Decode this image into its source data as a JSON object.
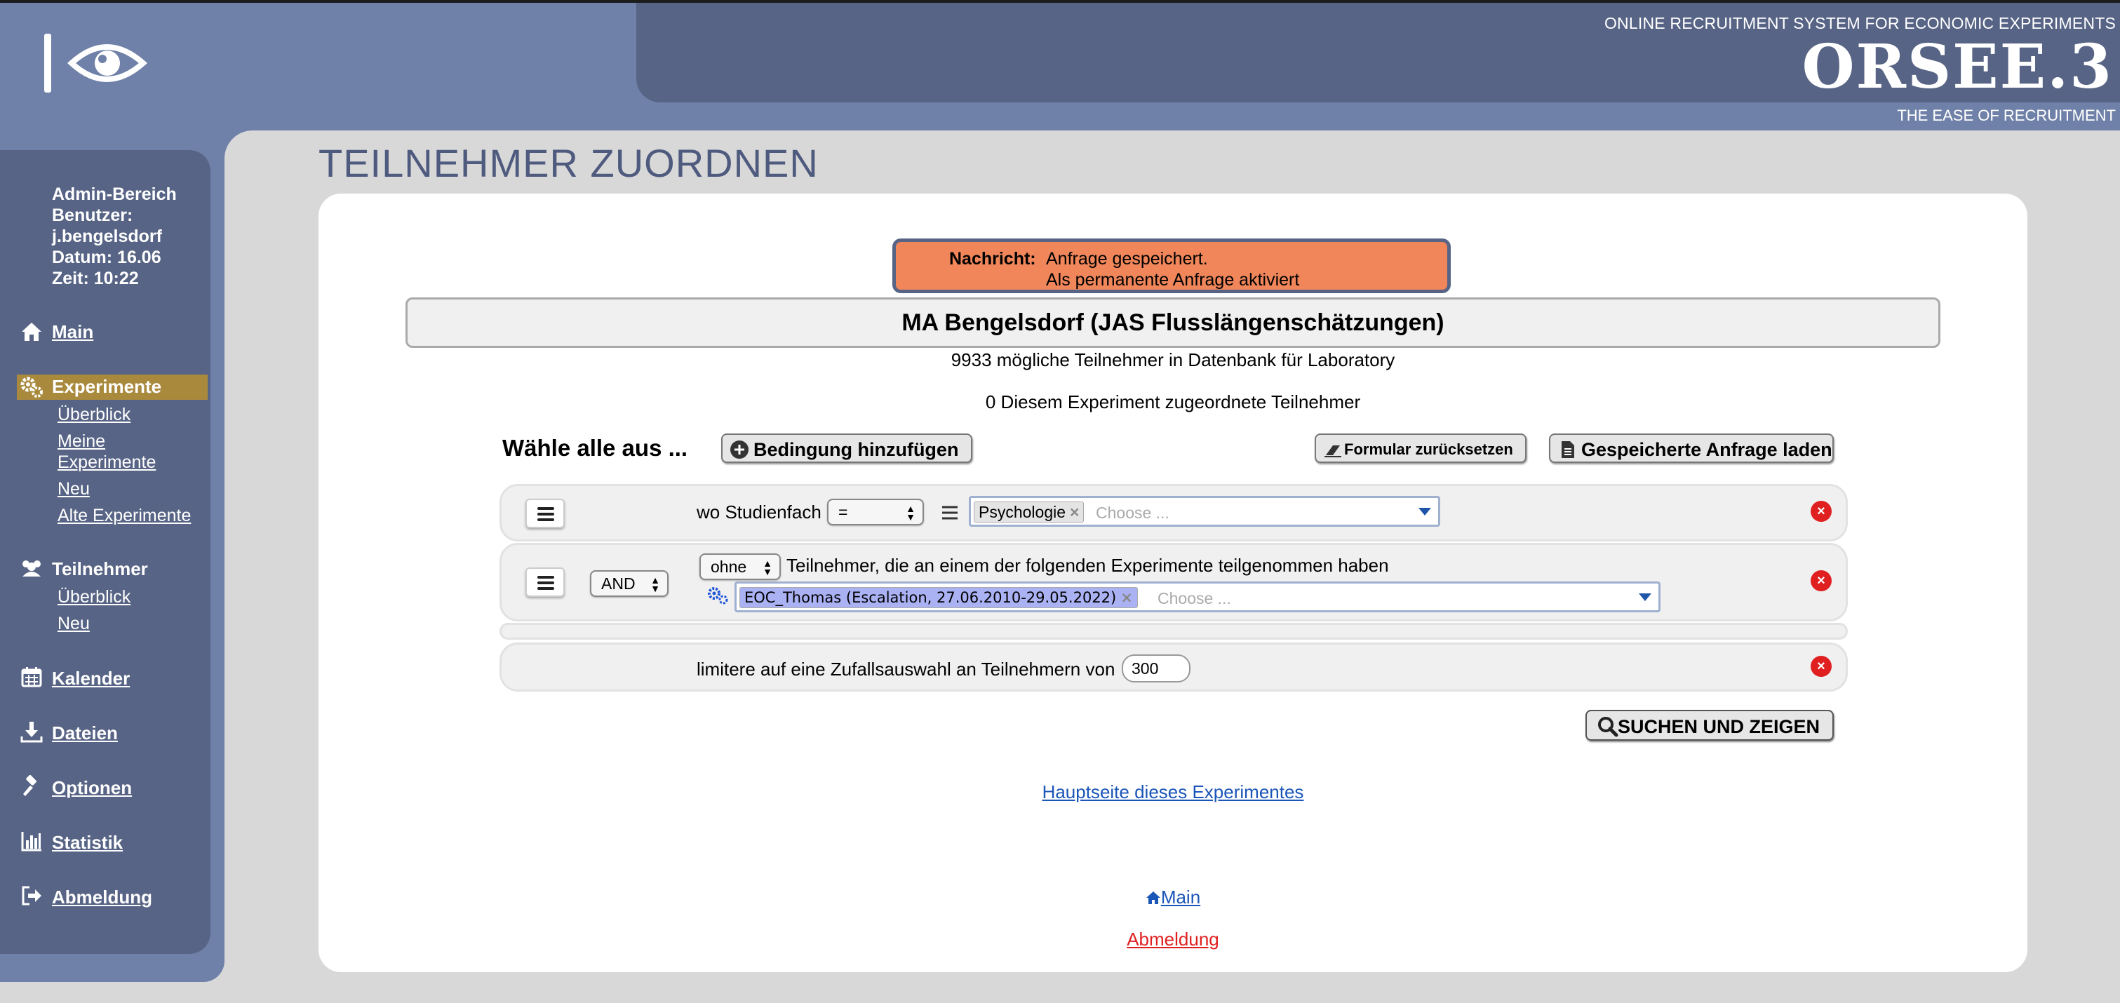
{
  "header": {
    "tagline": "ONLINE RECRUITMENT SYSTEM FOR ECONOMIC EXPERIMENTS",
    "logo_text": "ORSEE.3",
    "subtag": "THE EASE OF RECRUITMENT"
  },
  "sidebar": {
    "info": [
      "Admin-Bereich",
      "Benutzer:",
      "j.bengelsdorf",
      "Datum: 16.06",
      "Zeit: 10:22"
    ],
    "nav": [
      {
        "label": "Main",
        "icon": "home-icon"
      },
      {
        "label": "Experimente",
        "icon": "gears-icon",
        "active": true,
        "sub": [
          "Überblick",
          "Meine Experimente",
          "Neu",
          "Alte Experimente"
        ]
      },
      {
        "label": "Teilnehmer",
        "icon": "users-icon",
        "sub": [
          "Überblick",
          "Neu"
        ]
      },
      {
        "label": "Kalender",
        "icon": "calendar-icon"
      },
      {
        "label": "Dateien",
        "icon": "download-icon"
      },
      {
        "label": "Optionen",
        "icon": "gavel-icon"
      },
      {
        "label": "Statistik",
        "icon": "bar-chart-icon"
      },
      {
        "label": "Abmeldung",
        "icon": "sign-out-icon"
      }
    ],
    "sub_experimente_meine_1": "Meine",
    "sub_experimente_meine_2": "Experimente"
  },
  "page": {
    "title": "TEILNEHMER ZUORDNEN",
    "message": {
      "label": "Nachricht:",
      "line1": "Anfrage gespeichert.",
      "line2": "Als permanente Anfrage aktiviert"
    },
    "experiment_title": "MA Bengelsdorf (JAS Flusslängenschätzungen)",
    "possible_participants": "9933 mögliche Teilnehmer in Datenbank für Laboratory",
    "assigned_participants": "0 Diesem Experiment zugeordnete Teilnehmer"
  },
  "query": {
    "select_all_label": "Wähle alle aus ...",
    "add_condition_label": "Bedingung hinzufügen",
    "reset_form_label": "Formular zurücksetzen",
    "load_saved_label": "Gespeicherte Anfrage laden",
    "row1": {
      "prefix": "wo Studienfach",
      "operator": "=",
      "tag": "Psychologie",
      "placeholder": "Choose ..."
    },
    "row2": {
      "logic": "AND",
      "mode": "ohne",
      "text": "Teilnehmer, die an einem der folgenden Experimente teilgenommen haben",
      "tag": "EOC_Thomas (Escalation, 27.06.2010-29.05.2022)",
      "placeholder": "Choose ..."
    },
    "row3": {
      "prefix": "limitere auf eine Zufallsauswahl an Teilnehmern von",
      "limit_value": "300"
    },
    "search_label": "SUCHEN UND ZEIGEN"
  },
  "links": {
    "experiment_main": "Hauptseite dieses Experimentes",
    "main": "Main",
    "logout": "Abmeldung"
  },
  "colors": {
    "header_dark": "#576485",
    "header_light": "#6f81a8",
    "message_bg": "#f0865a",
    "active_nav": "#a98a3d",
    "delete_red": "#e02020",
    "tag_blue": "#aab2f4"
  }
}
